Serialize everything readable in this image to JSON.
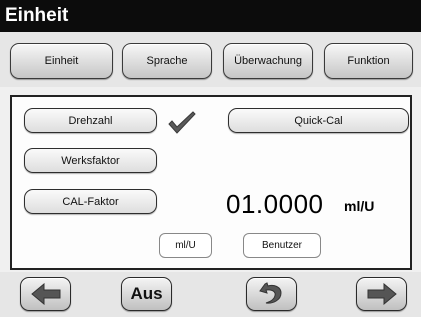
{
  "window": {
    "title": "Einheit"
  },
  "tabs": [
    {
      "label": "Einheit"
    },
    {
      "label": "Sprache"
    },
    {
      "label": "Überwachung"
    },
    {
      "label": "Funktion"
    }
  ],
  "panel": {
    "drehzahl_label": "Drehzahl",
    "quick_cal_label": "Quick-Cal",
    "werksfaktor_label": "Werksfaktor",
    "cal_faktor_label": "CAL-Faktor",
    "value": "01.0000",
    "unit": "ml/U",
    "unit_option_mlu": "ml/U",
    "unit_option_benutzer": "Benutzer"
  },
  "nav": {
    "back_icon": "arrow-left-icon",
    "aus_label": "Aus",
    "undo_icon": "undo-arrow-icon",
    "forward_icon": "arrow-right-icon"
  },
  "colors": {
    "titlebar": "#0c0c0c",
    "accent": "#4a4a4a"
  }
}
